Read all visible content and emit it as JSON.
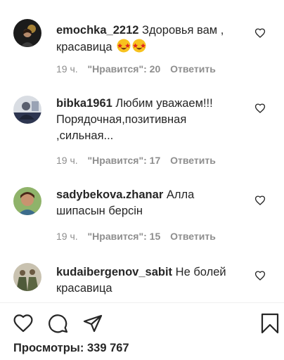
{
  "comments": [
    {
      "username": "emochka_2212",
      "text": "Здоровья вам , красавица",
      "emoji": [
        "star-struck-emoji",
        "star-struck-emoji"
      ],
      "time": "19 ч.",
      "likes": "\"Нравится\": 20",
      "reply": "Ответить"
    },
    {
      "username": "bibka1961",
      "text": "Любим уважаем!!! Порядочная,позитивная ,сильная...",
      "time": "19 ч.",
      "likes": "\"Нравится\": 17",
      "reply": "Ответить"
    },
    {
      "username": "sadybekova.zhanar",
      "text": "Алла шипасын берсін",
      "time": "19 ч.",
      "likes": "\"Нравится\": 15",
      "reply": "Ответить"
    },
    {
      "username": "kudaibergenov_sabit",
      "text": "Не болей красавица"
    }
  ],
  "actions": {
    "icons": [
      "heart-icon",
      "comment-icon",
      "share-icon",
      "bookmark-icon"
    ]
  },
  "views": "Просмотры: 339 767",
  "colors": {
    "text": "#262626",
    "meta": "#8e8e8e",
    "divider": "#efefef"
  }
}
